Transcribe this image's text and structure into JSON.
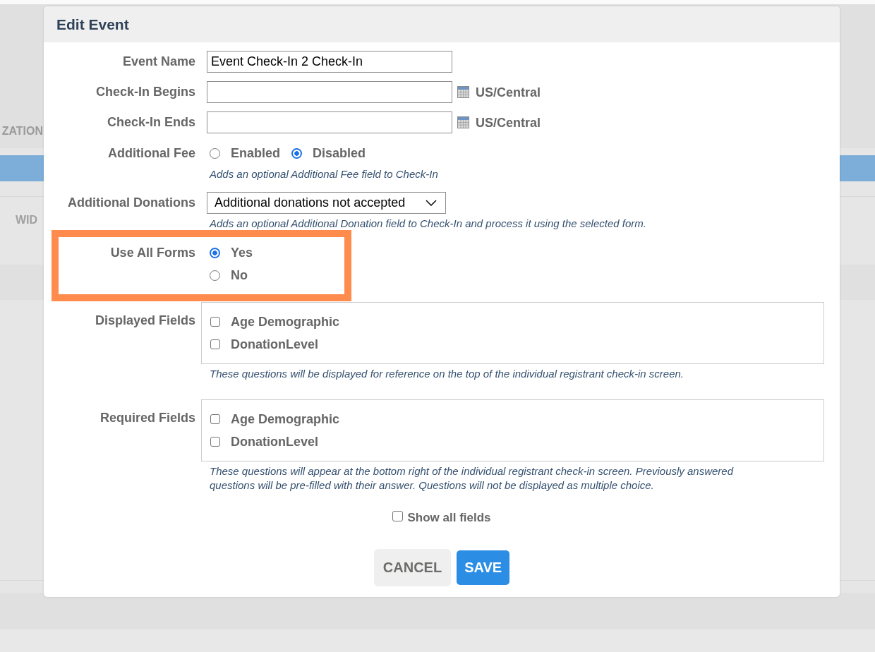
{
  "background": {
    "section_heading": "ZATION",
    "tab_label": "WID"
  },
  "dialog": {
    "title": "Edit Event",
    "fields": [
      {
        "kind": "text",
        "label": "Event Name",
        "value": "Event Check-In 2 Check-In",
        "highlighted": false
      },
      {
        "kind": "date",
        "label": "Check-In Begins",
        "timezone": "US/Central",
        "highlighted": false
      },
      {
        "kind": "date",
        "label": "Check-In Ends",
        "timezone": "US/Central",
        "highlighted": false
      },
      {
        "kind": "radiorow",
        "label": "Additional Fee",
        "options": [
          {
            "label": "Enabled",
            "selected": false
          },
          {
            "label": "Disabled",
            "selected": true
          }
        ],
        "help": "Adds an optional Additional Fee field to Check-In",
        "highlighted": false
      },
      {
        "kind": "select",
        "label": "Additional Donations",
        "value": "Additional donations not accepted",
        "help": "Adds an optional Additional Donation field to Check-In and process it using the selected form.",
        "highlighted": false
      },
      {
        "kind": "radiocolumn",
        "label": "Use All Forms",
        "options": [
          {
            "label": "Yes",
            "selected": true
          },
          {
            "label": "No",
            "selected": false
          }
        ],
        "highlighted": true
      },
      {
        "kind": "checklist",
        "label": "Displayed Fields",
        "options": [
          {
            "label": "Age Demographic",
            "checked": false
          },
          {
            "label": "DonationLevel",
            "checked": false
          }
        ],
        "help": "These questions will be displayed for reference on the top of the individual registrant check-in screen.",
        "highlighted": false
      },
      {
        "kind": "checklist",
        "label": "Required Fields",
        "options": [
          {
            "label": "Age Demographic",
            "checked": false
          },
          {
            "label": "DonationLevel",
            "checked": false
          }
        ],
        "help": "These questions will appear at the bottom right of the individual registrant check-in screen. Previously answered questions will be pre-filled with their answer. Questions will not be displayed as multiple choice.",
        "highlighted": false
      }
    ],
    "show_all_fields": {
      "label": "Show all fields",
      "checked": false
    },
    "buttons": [
      {
        "label": "CANCEL",
        "kind": "secondary"
      },
      {
        "label": "SAVE",
        "kind": "primary"
      }
    ]
  }
}
